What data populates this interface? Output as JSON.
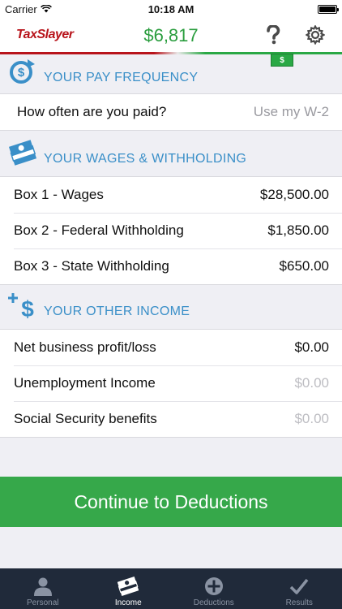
{
  "status_bar": {
    "carrier": "Carrier",
    "time": "10:18 AM"
  },
  "header": {
    "logo": "TaxSlayer",
    "refund_amount": "$6,817",
    "help_icon": "question-mark-icon",
    "settings_icon": "gear-icon",
    "badge_label": "$"
  },
  "pay_frequency": {
    "title": "YOUR PAY FREQUENCY",
    "icon": "dollar-refresh-icon",
    "rows": [
      {
        "label": "How often are you paid?",
        "value": "Use my W-2"
      }
    ]
  },
  "wages": {
    "title": "YOUR WAGES & WITHHOLDING",
    "icon": "money-stack-icon",
    "rows": [
      {
        "label": "Box 1 - Wages",
        "value": "$28,500.00"
      },
      {
        "label": "Box 2 - Federal Withholding",
        "value": "$1,850.00"
      },
      {
        "label": "Box 3 - State Withholding",
        "value": "$650.00"
      }
    ]
  },
  "other_income": {
    "title": "YOUR OTHER INCOME",
    "icon": "plus-dollar-icon",
    "rows": [
      {
        "label": "Net business profit/loss",
        "value": "$0.00"
      },
      {
        "label": "Unemployment Income",
        "value": "$0.00"
      },
      {
        "label": "Social Security benefits",
        "value": "$0.00"
      }
    ]
  },
  "cta": {
    "label": "Continue to Deductions"
  },
  "tabs": [
    {
      "label": "Personal",
      "icon": "person-icon"
    },
    {
      "label": "Income",
      "icon": "money-stack-icon"
    },
    {
      "label": "Deductions",
      "icon": "cross-circle-icon"
    },
    {
      "label": "Results",
      "icon": "checkmark-icon"
    }
  ],
  "colors": {
    "brand_red": "#b8141b",
    "refund_green": "#2a9d3e",
    "section_blue": "#3a8fc8",
    "cta_green": "#36a84a",
    "tabbar_bg": "#202a3a"
  }
}
